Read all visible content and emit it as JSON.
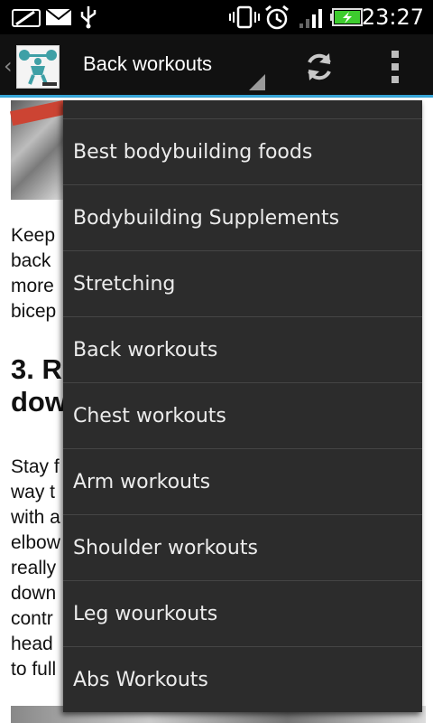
{
  "status_bar": {
    "time": "23:27",
    "icons": [
      "message-icon",
      "mail-icon",
      "usb-icon",
      "vibrate-icon",
      "alarm-icon",
      "signal-icon",
      "battery-charging-icon"
    ],
    "battery_color": "#3dcc2e"
  },
  "action_bar": {
    "title": "Back workouts",
    "accent_color": "#37a6d8",
    "icons": [
      "back-chevron-icon",
      "app-logo",
      "refresh-icon",
      "overflow-menu-icon"
    ]
  },
  "content": {
    "para1": "Keep\nback\nmore\nbicep",
    "heading": "3. R\ndow",
    "para2": "Stay f\nway t\nwith a\nelbow\nreally\ndown\ncontr\nhead\nto full"
  },
  "dropdown": {
    "items": [
      {
        "label": ""
      },
      {
        "label": "Best bodybuilding foods"
      },
      {
        "label": "Bodybuilding Supplements"
      },
      {
        "label": "Stretching"
      },
      {
        "label": "Back workouts"
      },
      {
        "label": "Chest workouts"
      },
      {
        "label": "Arm workouts"
      },
      {
        "label": "Shoulder workouts"
      },
      {
        "label": "Leg wourkouts"
      },
      {
        "label": "Abs Workouts"
      }
    ]
  }
}
